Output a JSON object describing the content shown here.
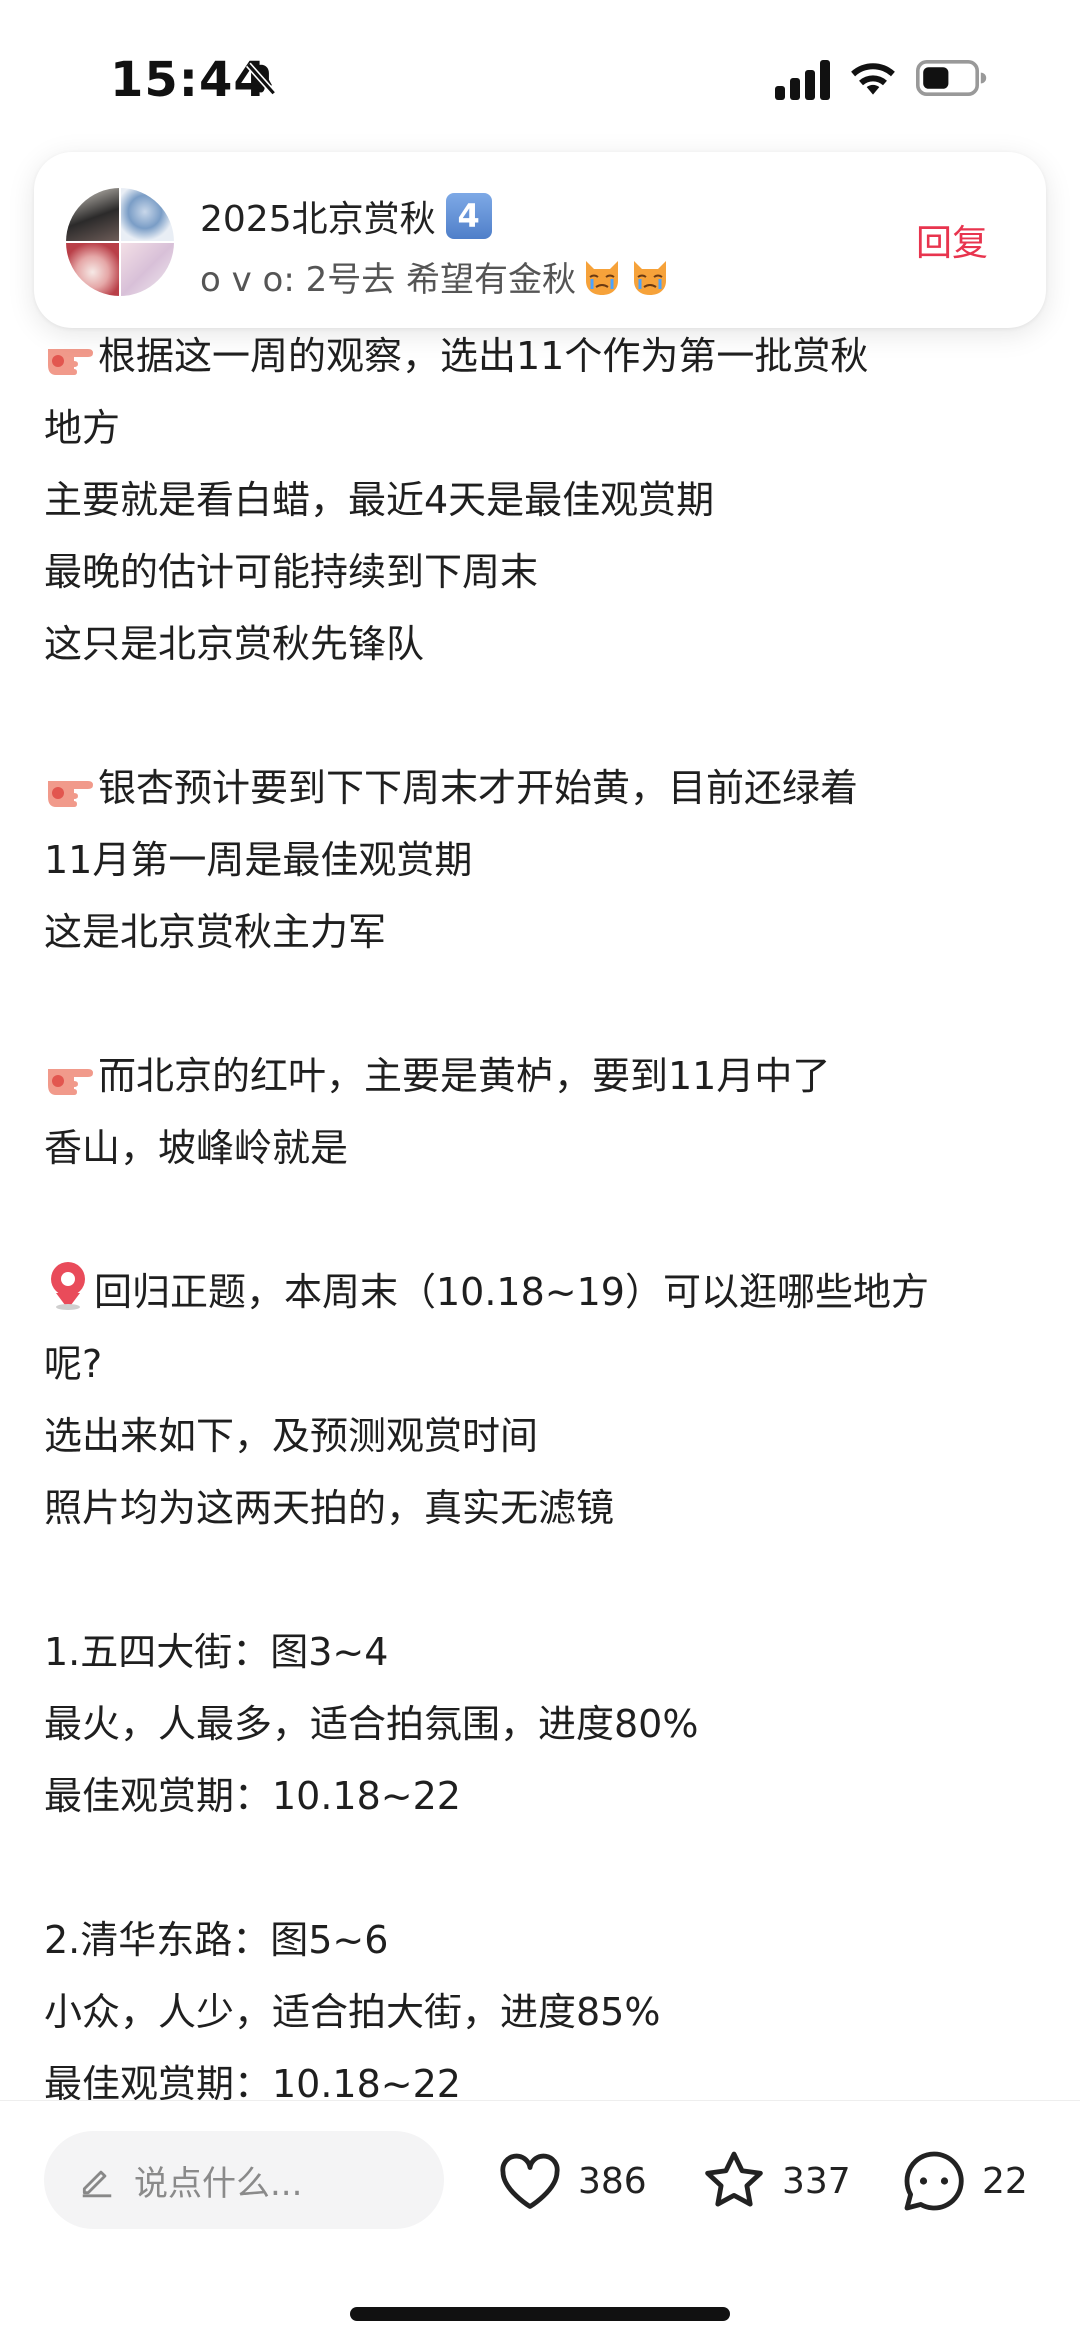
{
  "status_bar": {
    "time": "15:44"
  },
  "notification": {
    "title": "2025北京赏秋",
    "badge": "4",
    "message": "o v o: 2号去 希望有金秋",
    "reply_label": "回复"
  },
  "content": {
    "lines": [
      "根据这一周的观察，选出11个作为第一批赏秋",
      "地方",
      "主要就是看白蜡，最近4天是最佳观赏期",
      "最晚的估计可能持续到下周末",
      "这只是北京赏秋先锋队",
      "银杏预计要到下下周末才开始黄，目前还绿着",
      "11月第一周是最佳观赏期",
      "这是北京赏秋主力军",
      "而北京的红叶，主要是黄栌，要到11月中了",
      "香山，坡峰岭就是",
      "回归正题，本周末（10.18~19）可以逛哪些地方",
      "呢?",
      "选出来如下，及预测观赏时间",
      "照片均为这两天拍的，真实无滤镜",
      "1.五四大街：图3~4",
      "最火，人最多，适合拍氛围，进度80%",
      "最佳观赏期：10.18~22",
      "2.清华东路：图5~6",
      "小众，人少，适合拍大街，进度85%",
      "最佳观赏期：10.18~22"
    ]
  },
  "bottom_bar": {
    "comment_placeholder": "说点什么...",
    "likes": "386",
    "favorites": "337",
    "comments": "22"
  },
  "colors": {
    "reply": "#e8344e",
    "text": "#1f1f1f",
    "placeholder": "#8a8a8a"
  },
  "icons": [
    "bell-slash-icon",
    "signal-icon",
    "wifi-icon",
    "battery-icon",
    "pointing-hand-icon",
    "pin-icon",
    "cat-crying-icon",
    "pencil-icon",
    "heart-icon",
    "star-icon",
    "comment-bubble-icon"
  ]
}
